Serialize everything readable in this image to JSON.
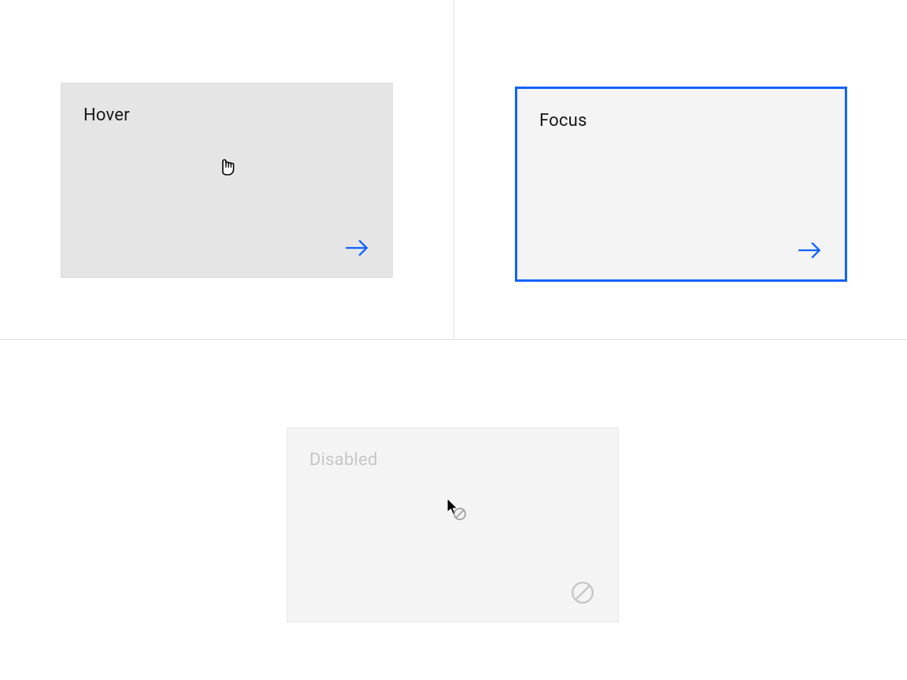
{
  "tiles": {
    "hover": {
      "label": "Hover"
    },
    "focus": {
      "label": "Focus"
    },
    "disabled": {
      "label": "Disabled"
    }
  },
  "colors": {
    "focus_border": "#0f62fe",
    "action_icon": "#0f62fe",
    "disabled_text": "#c6c6c6",
    "hover_bg": "#e5e5e5",
    "tile_bg": "#f4f4f4"
  }
}
